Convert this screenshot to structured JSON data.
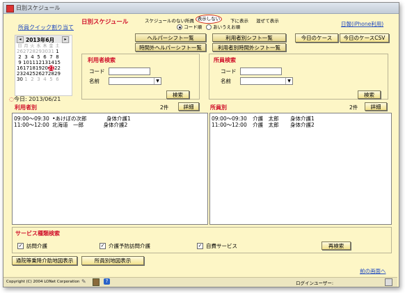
{
  "window": {
    "title": "日別スケジュール"
  },
  "left": {
    "quick_assign_link": "所員クイック割り当て",
    "calendar": {
      "month_label": "2013年6月",
      "prev": "◂",
      "next": "▸",
      "weekdays": [
        "日",
        "月",
        "火",
        "水",
        "木",
        "金",
        "土"
      ],
      "weeks": [
        [
          "26",
          "27",
          "28",
          "29",
          "30",
          "31",
          "1"
        ],
        [
          "2",
          "3",
          "4",
          "5",
          "6",
          "7",
          "8"
        ],
        [
          "9",
          "10",
          "11",
          "12",
          "13",
          "14",
          "15"
        ],
        [
          "16",
          "17",
          "18",
          "19",
          "20",
          "21",
          "22"
        ],
        [
          "23",
          "24",
          "25",
          "26",
          "27",
          "28",
          "29"
        ],
        [
          "30",
          "1",
          "2",
          "3",
          "4",
          "5",
          "6"
        ]
      ],
      "selected": "21"
    },
    "today_label": "今日: 2013/06/21"
  },
  "header": {
    "title": "日別スケジュール",
    "options_row": {
      "no_schedule_label": "スケジュールのない所員",
      "hide_button": "表示しない",
      "show_below": "下に表示",
      "mixed_show": "混ぜて表示"
    },
    "sort": {
      "code": "コード順",
      "kana": "あいうえお順"
    },
    "buttons": {
      "helper_shift_list": "ヘルパーシフト一覧",
      "user_shift_list": "利用者別シフト一覧",
      "overtime_helper_shift_list": "時間外ヘルパーシフト一覧",
      "user_overtime_shift_list": "利用者別時間外シフト一覧"
    },
    "daily_report_link": "日報(iPhone利用)",
    "today_case_button": "今日のケース",
    "today_case_csv_button": "今日のケースCSV"
  },
  "user_search": {
    "title": "利用者検索",
    "code_label": "コード",
    "name_label": "名前",
    "code_value": "",
    "name_value": "",
    "search_button": "検索"
  },
  "staff_search": {
    "title": "所員検索",
    "code_label": "コード",
    "name_label": "名前",
    "code_value": "",
    "name_value": "",
    "search_button": "検索"
  },
  "by_user": {
    "title": "利用者別",
    "count": "2件",
    "detail_button": "詳細",
    "rows": [
      {
        "time": "09:00～09:30",
        "name": "•あけぼの次郎",
        "service": "身体介護1"
      },
      {
        "time": "11:00～12:00",
        "name": "北海道　一郎",
        "service": "身体介護2"
      }
    ]
  },
  "by_staff": {
    "title": "所員別",
    "count": "2件",
    "detail_button": "詳細",
    "rows": [
      {
        "time": "09:00～09:30",
        "name": "介護　太郎",
        "service": "身体介護1"
      },
      {
        "time": "11:00～12:00",
        "name": "介護　太郎",
        "service": "身体介護2"
      }
    ]
  },
  "service_types": {
    "title": "サービス種類検索",
    "items": [
      "訪問介護",
      "介護予防訪問介護",
      "自費サービス"
    ],
    "research_button": "再検索"
  },
  "bottom": {
    "map_button_left": "通院等乗降介助地図表示",
    "map_button_right": "所員別地図表示",
    "back_link": "前の画面へ",
    "copyright": "Copyright (C) 2004 LONet Corporation",
    "login_user_label": "ログインユーザー:"
  }
}
